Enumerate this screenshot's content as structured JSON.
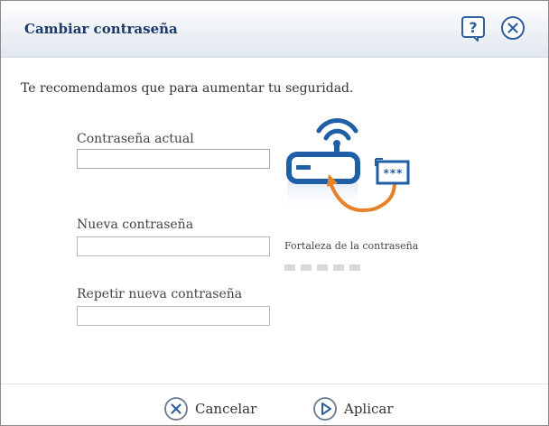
{
  "dialog": {
    "title": "Cambiar contraseña",
    "icons": {
      "help": "help-icon",
      "close": "close-icon"
    }
  },
  "intro_text": "Te recomendamos que para aumentar tu seguridad.",
  "fields": {
    "current": {
      "label": "Contraseña actual",
      "value": ""
    },
    "new": {
      "label": "Nueva contraseña",
      "value": ""
    },
    "repeat": {
      "label": "Repetir nueva contraseña",
      "value": ""
    }
  },
  "strength": {
    "label": "Fortaleza de la contraseña",
    "segments": 5,
    "filled": 0
  },
  "buttons": {
    "cancel": "Cancelar",
    "apply": "Aplicar"
  },
  "colors": {
    "accent_blue": "#1f5fa6",
    "accent_orange": "#e8822a",
    "title": "#1d3a6b"
  }
}
